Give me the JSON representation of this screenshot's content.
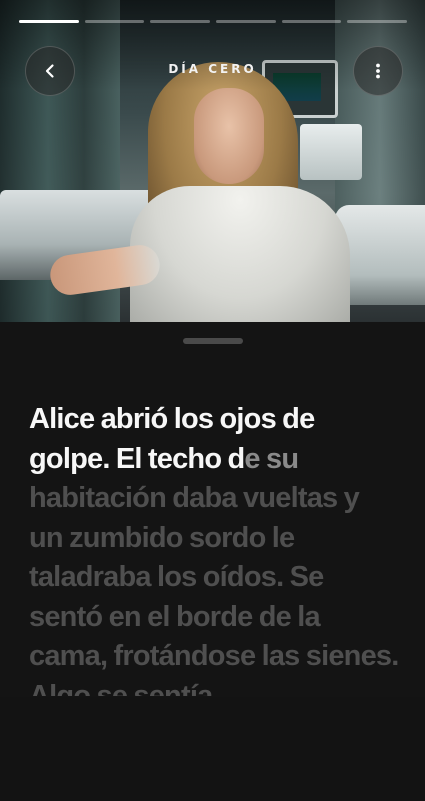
{
  "header": {
    "chapter_title": "DÍA CERO",
    "progress_segments_total": 6,
    "progress_segments_active": 1
  },
  "icons": {
    "back": "chevron-left-icon",
    "more": "more-vertical-icon"
  },
  "story": {
    "read_text": "Alice abrió los ojos de golpe. El techo d",
    "typing_text": "e su",
    "unread_text": " habitación daba vueltas y un zumbido sordo le taladraba los oídos. Se sentó en el borde de la cama, frotándose las sienes. Algo se sentía"
  },
  "colors": {
    "background": "#111111",
    "text_read": "#f7f7f7",
    "text_unread": "#4f4f4f"
  }
}
